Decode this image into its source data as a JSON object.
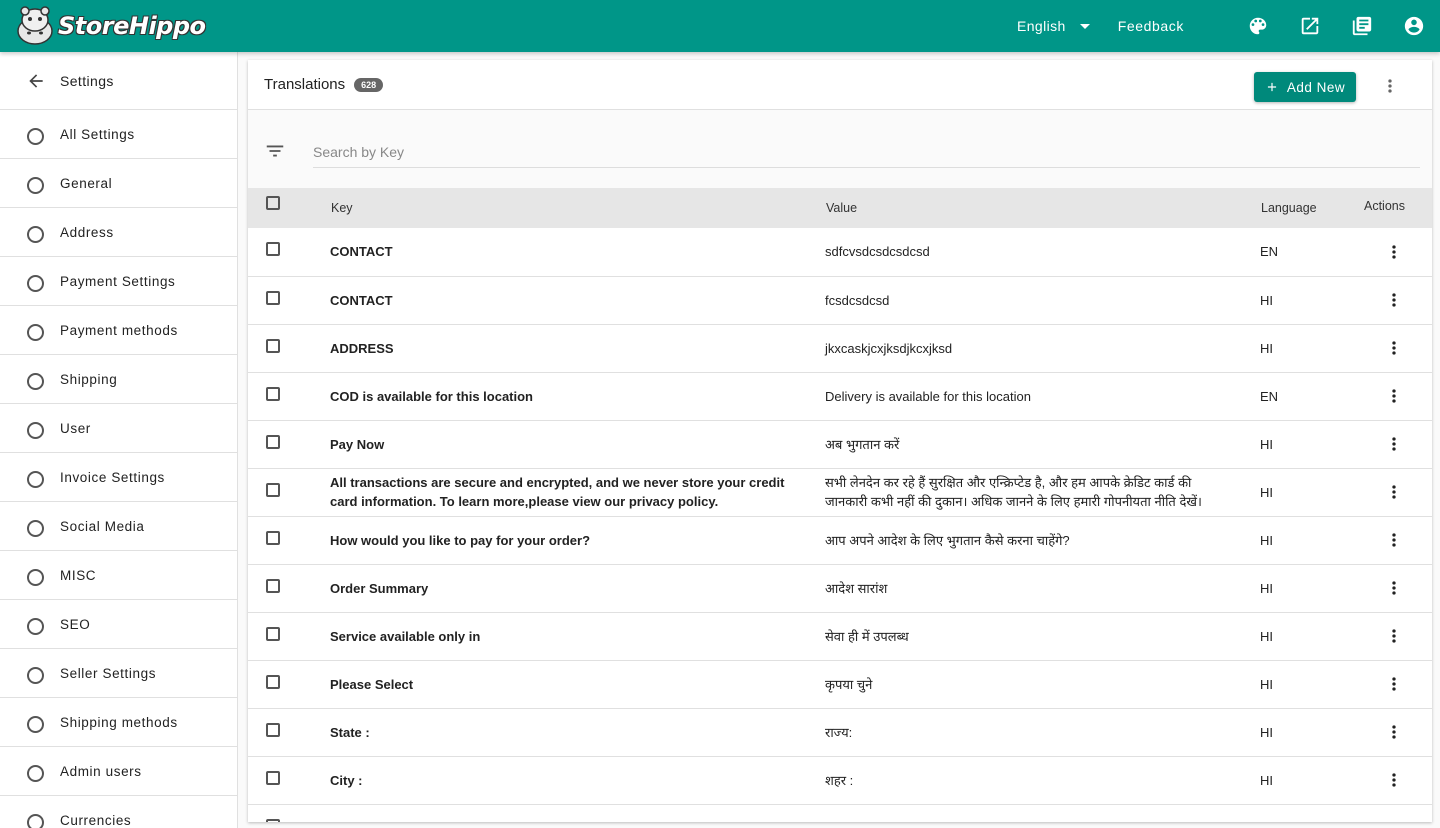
{
  "app": {
    "brand": "StoreHippo",
    "language": "English",
    "feedback": "Feedback"
  },
  "sidebar": {
    "title": "Settings",
    "items": [
      "All Settings",
      "General",
      "Address",
      "Payment Settings",
      "Payment methods",
      "Shipping",
      "User",
      "Invoice Settings",
      "Social Media",
      "MISC",
      "SEO",
      "Seller Settings",
      "Shipping methods",
      "Admin users",
      "Currencies"
    ]
  },
  "page": {
    "title": "Translations",
    "count": "628",
    "add_button": "Add New",
    "search_placeholder": "Search by Key"
  },
  "table": {
    "columns": {
      "key": "Key",
      "value": "Value",
      "language": "Language",
      "actions": "Actions"
    },
    "rows": [
      {
        "key": "CONTACT",
        "value": "sdfcvsdcsdcsdcsd",
        "lang": "EN"
      },
      {
        "key": "CONTACT",
        "value": "fcsdcsdcsd",
        "lang": "HI"
      },
      {
        "key": "ADDRESS",
        "value": "jkxcaskjcxjksdjkcxjksd",
        "lang": "HI"
      },
      {
        "key": "COD is available for this location",
        "value": "Delivery is available for this location",
        "lang": "EN"
      },
      {
        "key": "Pay Now",
        "value": "अब भुगतान करें",
        "lang": "HI"
      },
      {
        "key": "All transactions are secure and encrypted, and we never store your credit card information. To learn more,please view our privacy policy.",
        "value": "सभी लेनदेन कर रहे हैं सुरक्षित और एन्क्रिप्टेड है, और हम आपके क्रेडिट कार्ड की जानकारी कभी नहीं की दुकान। अधिक जानने के लिए हमारी गोपनीयता नीति देखें।",
        "lang": "HI"
      },
      {
        "key": "How would you like to pay for your order?",
        "value": "आप अपने आदेश के लिए भुगतान कैसे करना चाहेंगे?",
        "lang": "HI"
      },
      {
        "key": "Order Summary",
        "value": "आदेश सारांश",
        "lang": "HI"
      },
      {
        "key": "Service available only in",
        "value": "सेवा ही में उपलब्ध",
        "lang": "HI"
      },
      {
        "key": "Please Select",
        "value": "कृपया चुने",
        "lang": "HI"
      },
      {
        "key": "State :",
        "value": "राज्य:",
        "lang": "HI"
      },
      {
        "key": "City :",
        "value": "शहर :",
        "lang": "HI"
      },
      {
        "key": "",
        "value": "",
        "lang": ""
      }
    ]
  },
  "colors": {
    "primary": "#009688",
    "button": "#00897b"
  },
  "icons": [
    "palette-icon",
    "open-in-new-icon",
    "library-books-icon",
    "account-circle-icon",
    "arrow-back-icon",
    "filter-list-icon",
    "more-vert-icon",
    "add-icon"
  ]
}
